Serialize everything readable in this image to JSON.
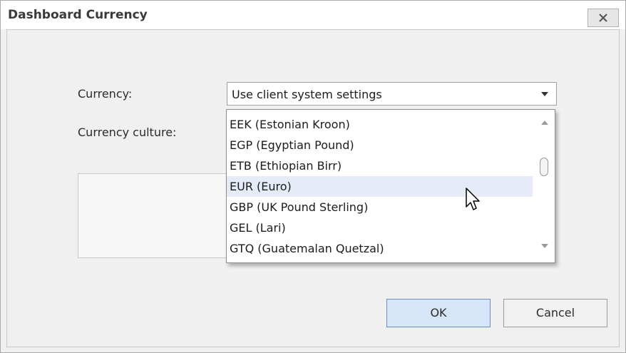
{
  "dialog": {
    "title": "Dashboard Currency",
    "close_icon": "close-icon"
  },
  "form": {
    "currency_label": "Currency:",
    "currency_culture_label": "Currency culture:",
    "currency_value": "Use client system settings"
  },
  "dropdown": {
    "items": [
      {
        "label": "EEK (Estonian Kroon)"
      },
      {
        "label": "EGP (Egyptian Pound)"
      },
      {
        "label": "ETB (Ethiopian Birr)"
      },
      {
        "label": "EUR (Euro)",
        "hovered": true
      },
      {
        "label": "GBP (UK Pound Sterling)"
      },
      {
        "label": "GEL (Lari)"
      },
      {
        "label": "GTQ (Guatemalan Quetzal)"
      }
    ]
  },
  "buttons": {
    "ok": "OK",
    "cancel": "Cancel"
  },
  "colors": {
    "hover_row": "#e5ecf8",
    "ok_button": "#d6e6f8"
  }
}
